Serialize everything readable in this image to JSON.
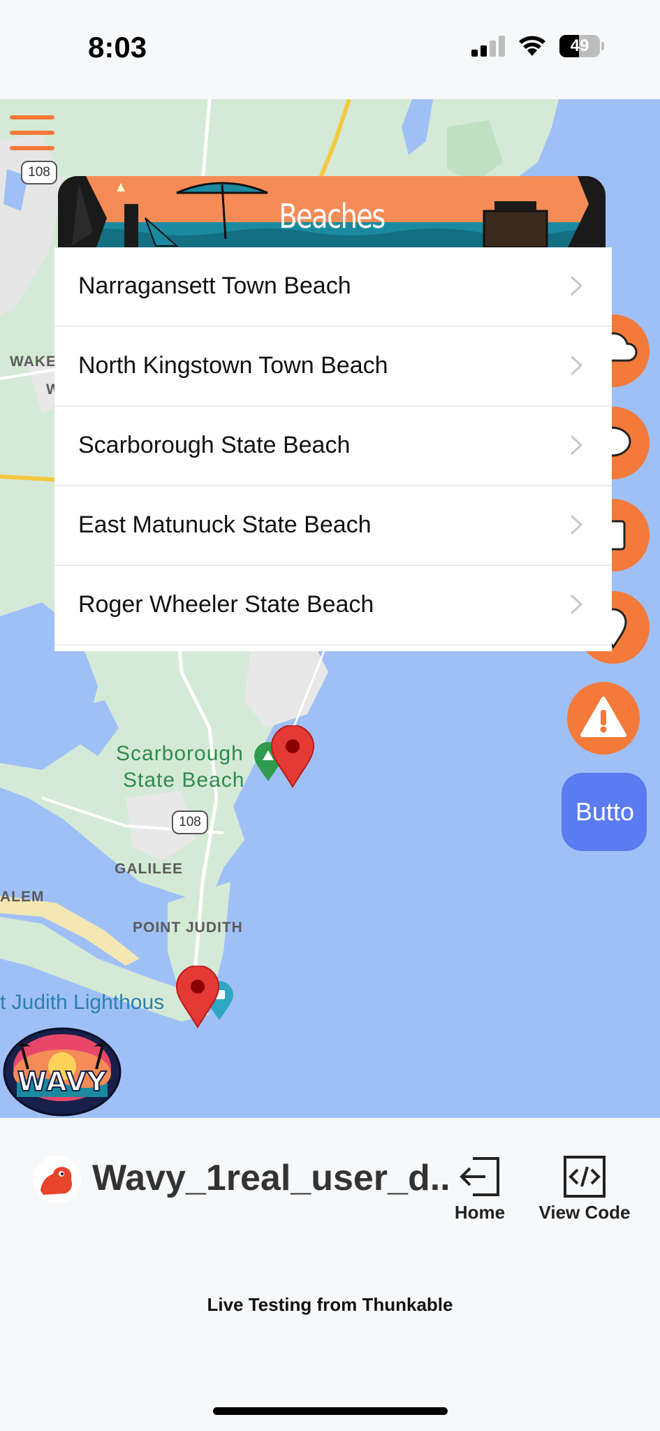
{
  "status_bar": {
    "time": "8:03",
    "battery_percent": 49,
    "battery_label": "49",
    "signal_icon": "cellular-signal-icon",
    "wifi_icon": "wifi-icon"
  },
  "map": {
    "labels": {
      "wake": "WAKE",
      "w": "W",
      "scarborough_park_line1": "Scarborough",
      "scarborough_park_line2": "State Beach",
      "galilee": "GALILEE",
      "alem": "ALEM",
      "point_judith": "POINT JUDITH",
      "lighthouse": "t Judith Lighthous"
    },
    "route_shield_top": "108",
    "route_shield_middle": "108",
    "colors": {
      "water": "#9fc0f7",
      "land": "#d5ead6",
      "marker": "#e53935"
    }
  },
  "header": {
    "menu_icon": "hamburger-menu-icon",
    "banner_title": "Beaches"
  },
  "beaches": [
    {
      "label": "Narragansett Town Beach"
    },
    {
      "label": "North Kingstown Town Beach"
    },
    {
      "label": "Scarborough State Beach"
    },
    {
      "label": "East Matunuck State Beach"
    },
    {
      "label": "Roger Wheeler State Beach"
    }
  ],
  "side_buttons": {
    "icons": [
      "cloud-icon",
      "chat-bubble-icon",
      "photos-icon",
      "location-pin-icon",
      "warning-icon"
    ],
    "api_button_label": "Butto",
    "accent_color": "#f47a3a",
    "button_color": "#5b7bf0"
  },
  "logo": {
    "text": "WAVY"
  },
  "footer": {
    "project_name": "Wavy_1real_user_d...",
    "home_label": "Home",
    "view_code_label": "View Code",
    "live_testing_text": "Live Testing from Thunkable"
  }
}
